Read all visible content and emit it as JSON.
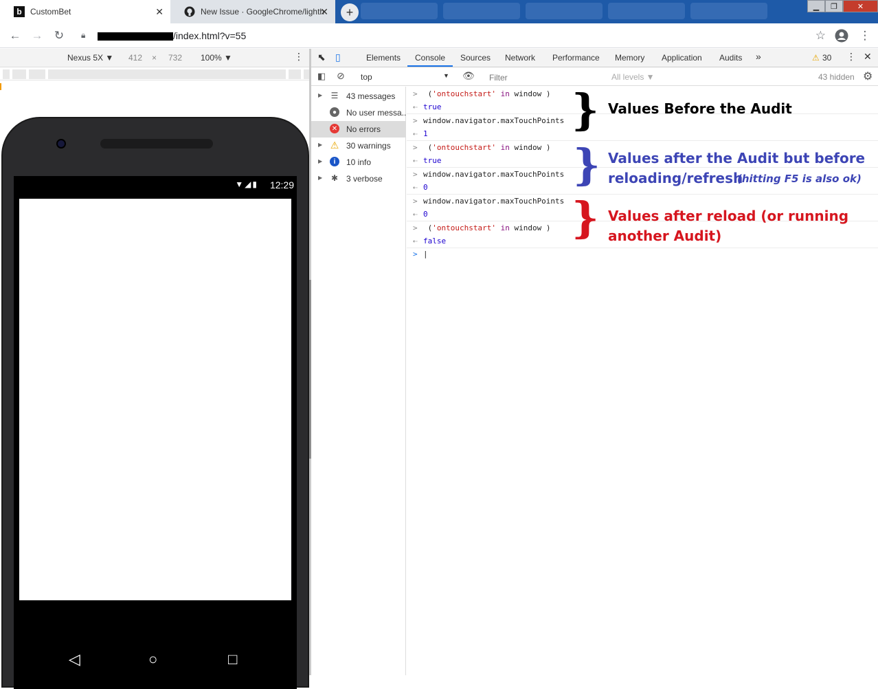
{
  "browser": {
    "tabs": [
      {
        "title": "CustomBet",
        "favicon": "b"
      },
      {
        "title": "New Issue · GoogleChrome/lighth",
        "favicon": "github"
      }
    ],
    "new_tab": "+",
    "url": "/index.html?v=55"
  },
  "device_toolbar": {
    "device": "Nexus 5X ▼",
    "width": "412",
    "times": "×",
    "height": "732",
    "zoom": "100% ▼"
  },
  "phone": {
    "time": "12:29",
    "status_icons": "▼◢▮"
  },
  "devtools": {
    "tabs": [
      "Elements",
      "Console",
      "Sources",
      "Network",
      "Performance",
      "Memory",
      "Application",
      "Audits"
    ],
    "more": "»",
    "warnings_count": "30",
    "context": "top",
    "filter_placeholder": "Filter",
    "levels": "All levels ▼",
    "hidden": "43 hidden",
    "sidebar": [
      {
        "label": "43 messages",
        "icon": "list-icon"
      },
      {
        "label": "No user messa...",
        "icon": "user-icon"
      },
      {
        "label": "No errors",
        "icon": "error-icon"
      },
      {
        "label": "30 warnings",
        "icon": "warning-icon"
      },
      {
        "label": "10 info",
        "icon": "info-icon"
      },
      {
        "label": "3 verbose",
        "icon": "bug-icon"
      }
    ]
  },
  "console_lines": [
    {
      "prefix": ">",
      "parts": [
        " (",
        "'ontouchstart'",
        " in ",
        "window",
        " )"
      ]
    },
    {
      "prefix": "<",
      "parts": [
        "true"
      ]
    },
    {
      "prefix": ">",
      "parts": [
        "window.navigator.maxTouchPoints"
      ]
    },
    {
      "prefix": "<",
      "parts": [
        "1"
      ]
    },
    {
      "prefix": ">",
      "parts": [
        " (",
        "'ontouchstart'",
        " in ",
        "window",
        " )"
      ]
    },
    {
      "prefix": "<",
      "parts": [
        "true"
      ]
    },
    {
      "prefix": ">",
      "parts": [
        "window.navigator.maxTouchPoints"
      ]
    },
    {
      "prefix": "<",
      "parts": [
        "0"
      ]
    },
    {
      "prefix": ">",
      "parts": [
        "window.navigator.maxTouchPoints"
      ]
    },
    {
      "prefix": "<",
      "parts": [
        "0"
      ]
    },
    {
      "prefix": ">",
      "parts": [
        " (",
        "'ontouchstart'",
        " in ",
        "window",
        " )"
      ]
    },
    {
      "prefix": "<",
      "parts": [
        "false"
      ]
    },
    {
      "prefix": ">",
      "parts": [
        "|"
      ]
    }
  ],
  "annotations": {
    "before": "Values Before the Audit",
    "after_line1": "Values after the Audit but before",
    "after_line2": "reloading/refresh",
    "after_note": "(hitting F5 is also ok)",
    "reload_line1": "Values after reload (or running",
    "reload_line2": "another Audit)"
  },
  "colors": {
    "before": "#000000",
    "after": "#3d45b5",
    "reload": "#d6161f",
    "accent": "#1a73e8"
  }
}
